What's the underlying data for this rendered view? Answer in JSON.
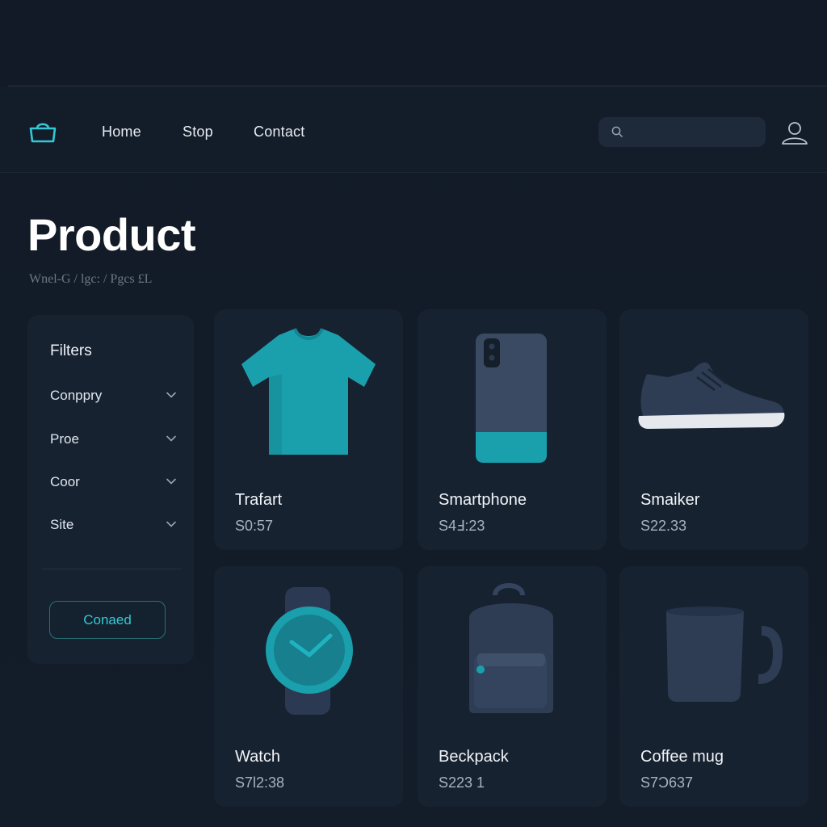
{
  "nav": {
    "links": [
      "Home",
      "Stop",
      "Contact"
    ],
    "search_placeholder": "",
    "logo_icon": "basket-icon",
    "search_icon": "search-icon",
    "user_icon": "user-icon"
  },
  "page": {
    "title": "Product",
    "subtitle": "Wnel-G / lgc: / Pgcs £L"
  },
  "filters": {
    "title": "Filters",
    "items": [
      {
        "label": "Conppry",
        "icon": "chevron-down-icon"
      },
      {
        "label": "Proe",
        "icon": "chevron-down-icon"
      },
      {
        "label": "Coor",
        "icon": "chevron-down-icon"
      },
      {
        "label": "Site",
        "icon": "chevron-down-icon"
      }
    ],
    "button_label": "Conaed"
  },
  "products": [
    {
      "name": "Trafart",
      "price": "S0:57",
      "image": "t-shirt-icon"
    },
    {
      "name": "Smartphone",
      "price": "S4Ⅎ:23",
      "image": "smartphone-icon"
    },
    {
      "name": "Smaiker",
      "price": "S22.33",
      "image": "sneaker-icon"
    },
    {
      "name": "Watch",
      "price": "S7l2:38",
      "image": "watch-icon"
    },
    {
      "name": "Beckpack",
      "price": "S223 1",
      "image": "backpack-icon"
    },
    {
      "name": "Coffee mug",
      "price": "S7Ͻ637",
      "image": "coffee-mug-icon"
    }
  ],
  "colors": {
    "background": "#121b28",
    "panel": "#172231",
    "accent": "#35c8d4",
    "accent_product": "#1aa0ad",
    "text": "#e8edf3",
    "muted": "#a8b1bd"
  }
}
